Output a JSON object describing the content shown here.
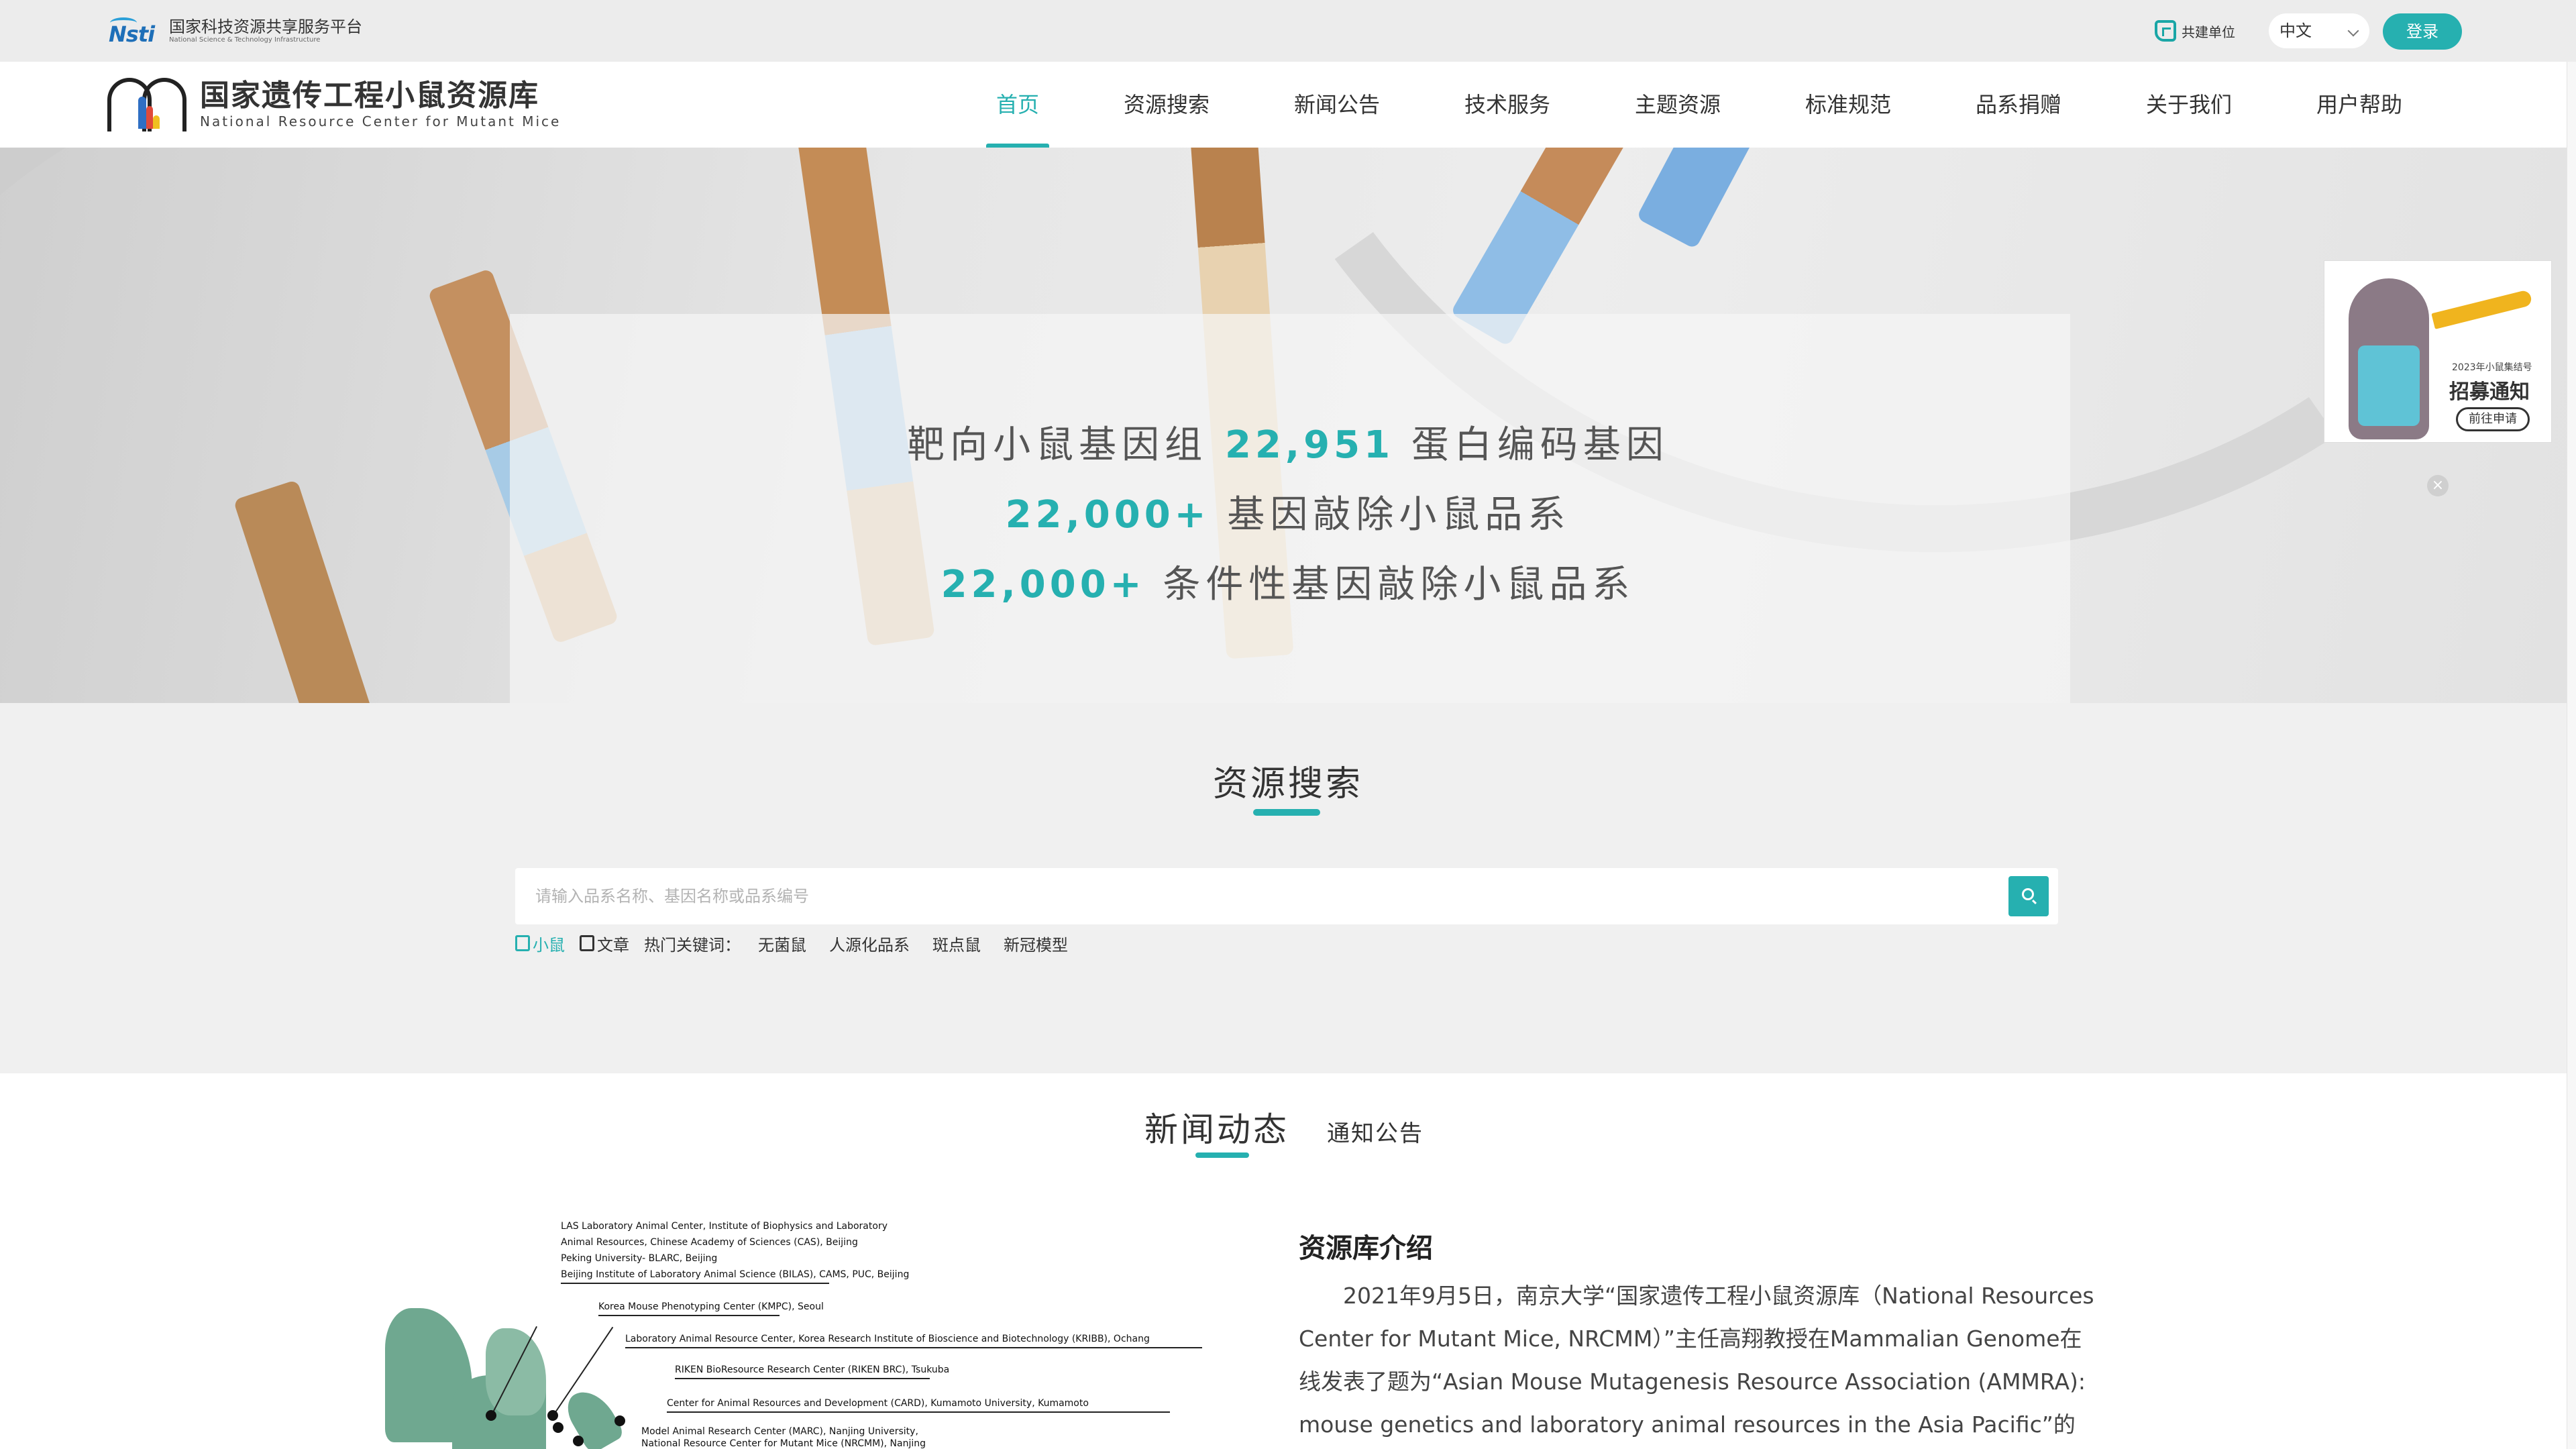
{
  "platform": {
    "name_cn": "国家科技资源共享服务平台",
    "name_en": "National Science & Technology Infrastructure",
    "logo_text": "Nsti",
    "partner_label": "共建单位",
    "language": "中文",
    "login_label": "登录"
  },
  "site": {
    "title_cn": "国家遗传工程小鼠资源库",
    "title_en": "National Resource Center for Mutant Mice"
  },
  "nav": {
    "items": [
      {
        "label": "首页",
        "active": true
      },
      {
        "label": "资源搜索",
        "active": false
      },
      {
        "label": "新闻公告",
        "active": false
      },
      {
        "label": "技术服务",
        "active": false
      },
      {
        "label": "主题资源",
        "active": false
      },
      {
        "label": "标准规范",
        "active": false
      },
      {
        "label": "品系捐赠",
        "active": false
      },
      {
        "label": "关于我们",
        "active": false
      },
      {
        "label": "用户帮助",
        "active": false
      }
    ]
  },
  "hero": {
    "line1_prefix": "靶向小鼠基因组",
    "line1_number": "22,951",
    "line1_suffix": "蛋白编码基因",
    "line2_number": "22,000+",
    "line2_suffix": "基因敲除小鼠品系",
    "line3_number": "22,000+",
    "line3_suffix": "条件性基因敲除小鼠品系"
  },
  "ad": {
    "small_text": "2023年小鼠集结号",
    "title": "招募通知",
    "button": "前往申请",
    "close_icon": "×"
  },
  "search": {
    "title": "资源搜索",
    "placeholder": "请输入品系名称、基因名称或品系编号",
    "options": [
      "小鼠",
      "文章"
    ],
    "active_option": "小鼠",
    "hot_label": "热门关键词：",
    "keywords": [
      "无菌鼠",
      "人源化品系",
      "斑点鼠",
      "新冠模型"
    ]
  },
  "news": {
    "tab_active": "新闻动态",
    "tab_other": "通知公告",
    "article_title": "资源库介绍",
    "article_body": "2021年9月5日，南京大学“国家遗传工程小鼠资源库（National Resources Center for Mutant Mice, NRCMM）”主任高翔教授在Mammalian Genome在线发表了题为“Asian Mouse Mutagenesis Resource Association (AMMRA): mouse genetics and laboratory animal resources in the Asia Pacific”的文章，",
    "map_labels": [
      "LAS Laboratory Animal Center, Institute of Biophysics and Laboratory",
      "Animal Resources, Chinese Academy of Sciences (CAS), Beijing",
      "Peking University- BLARC, Beijing",
      "Beijing Institute of Laboratory Animal Science (BILAS), CAMS, PUC, Beijing",
      "Korea Mouse Phenotyping Center (KMPC), Seoul",
      "Laboratory Animal Resource Center, Korea Research Institute of Bioscience and Biotechnology (KRIBB), Ochang",
      "RIKEN BioResource Research Center (RIKEN BRC), Tsukuba",
      "Center for Animal Resources and Development (CARD), Kumamoto University, Kumamoto",
      "Model Animal Research Center (MARC), Nanjing University,",
      "National Resource Center for Mutant Mice (NRCMM), Nanjing"
    ]
  },
  "colors": {
    "accent": "#26b0b0",
    "text": "#333333",
    "page_bg": "#f0f0f0"
  }
}
